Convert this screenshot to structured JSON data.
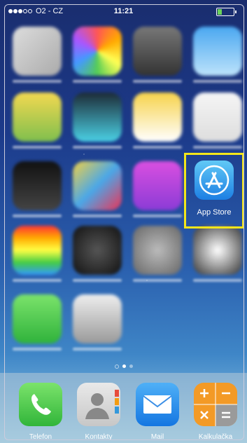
{
  "status_bar": {
    "signal": "●●●○○",
    "carrier": "O2 - CZ",
    "time": "11:21",
    "battery_level": 0.3
  },
  "highlight_app": {
    "label": "App Store",
    "highlight_color": "#f3e61a",
    "icon": "app-store-icon"
  },
  "page_indicator": {
    "pages": 3,
    "active_page": 1
  },
  "dock": [
    {
      "label": "Telefon",
      "icon": "phone-icon"
    },
    {
      "label": "Kontakty",
      "icon": "contacts-icon"
    },
    {
      "label": "Mail",
      "icon": "mail-icon"
    },
    {
      "label": "Kalkulačka",
      "icon": "calculator-icon"
    }
  ]
}
